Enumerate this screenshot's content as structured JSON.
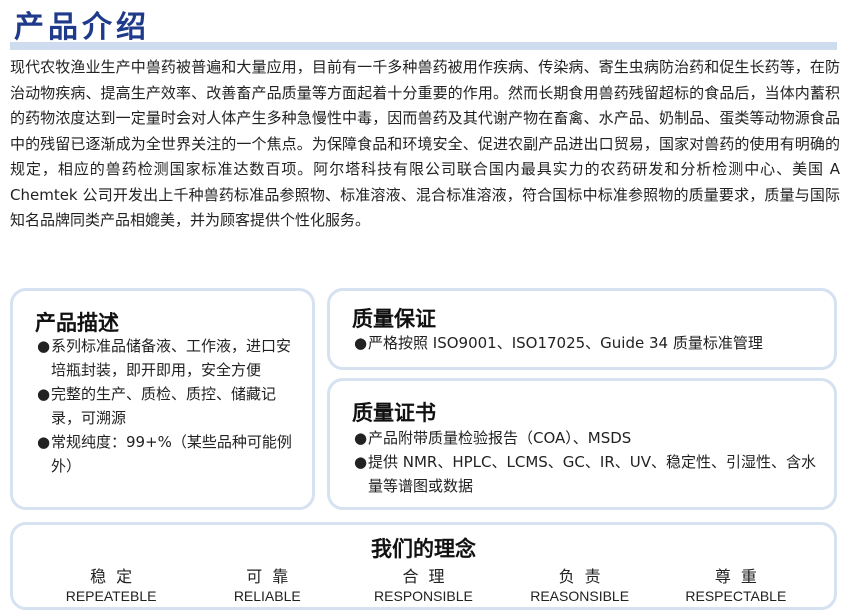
{
  "header": {
    "title": "产品介绍"
  },
  "intro": {
    "text": "现代农牧渔业生产中兽药被普遍和大量应用，目前有一千多种兽药被用作疾病、传染病、寄生虫病防治药和促生长药等，在防治动物疾病、提高生产效率、改善畜产品质量等方面起着十分重要的作用。然而长期食用兽药残留超标的食品后，当体内蓄积的药物浓度达到一定量时会对人体产生多种急慢性中毒，因而兽药及其代谢产物在畜禽、水产品、奶制品、蛋类等动物源食品中的残留已逐渐成为全世界关注的一个焦点。为保障食品和环境安全、促进农副产品进出口贸易，国家对兽药的使用有明确的规定，相应的兽药检测国家标准达数百项。阿尔塔科技有限公司联合国内最具实力的农药研发和分析检测中心、美国 A Chemtek 公司开发出上千种兽药标准品参照物、标准溶液、混合标准溶液，符合国标中标准参照物的质量要求，质量与国际知名品牌同类产品相媲美，并为顾客提供个性化服务。"
  },
  "description": {
    "heading": "产品描述",
    "items": [
      "系列标准品储备液、工作液，进口安培瓶封装，即开即用，安全方便",
      "完整的生产、质检、质控、储藏记录，可溯源",
      "常规纯度：99+%（某些品种可能例外）"
    ]
  },
  "quality_assurance": {
    "heading": "质量保证",
    "items": [
      "严格按照 ISO9001、ISO17025、Guide 34 质量标准管理"
    ]
  },
  "quality_certificate": {
    "heading": "质量证书",
    "items": [
      "产品附带质量检验报告（COA）、MSDS",
      "提供 NMR、HPLC、LCMS、GC、IR、UV、稳定性、引湿性、含水量等谱图或数据"
    ]
  },
  "philosophy": {
    "heading": "我们的理念",
    "values": [
      {
        "cn": "稳定",
        "en": "REPEATEBLE"
      },
      {
        "cn": "可靠",
        "en": "RELIABLE"
      },
      {
        "cn": "合理",
        "en": "RESPONSIBLE"
      },
      {
        "cn": "负责",
        "en": "REASONSIBLE"
      },
      {
        "cn": "尊重",
        "en": "RESPECTABLE"
      }
    ]
  },
  "bullet_symbol": "●",
  "colors": {
    "title": "#1f3a8a",
    "card_border": "#d6e1f1",
    "title_rule": "#cfdcf0"
  }
}
